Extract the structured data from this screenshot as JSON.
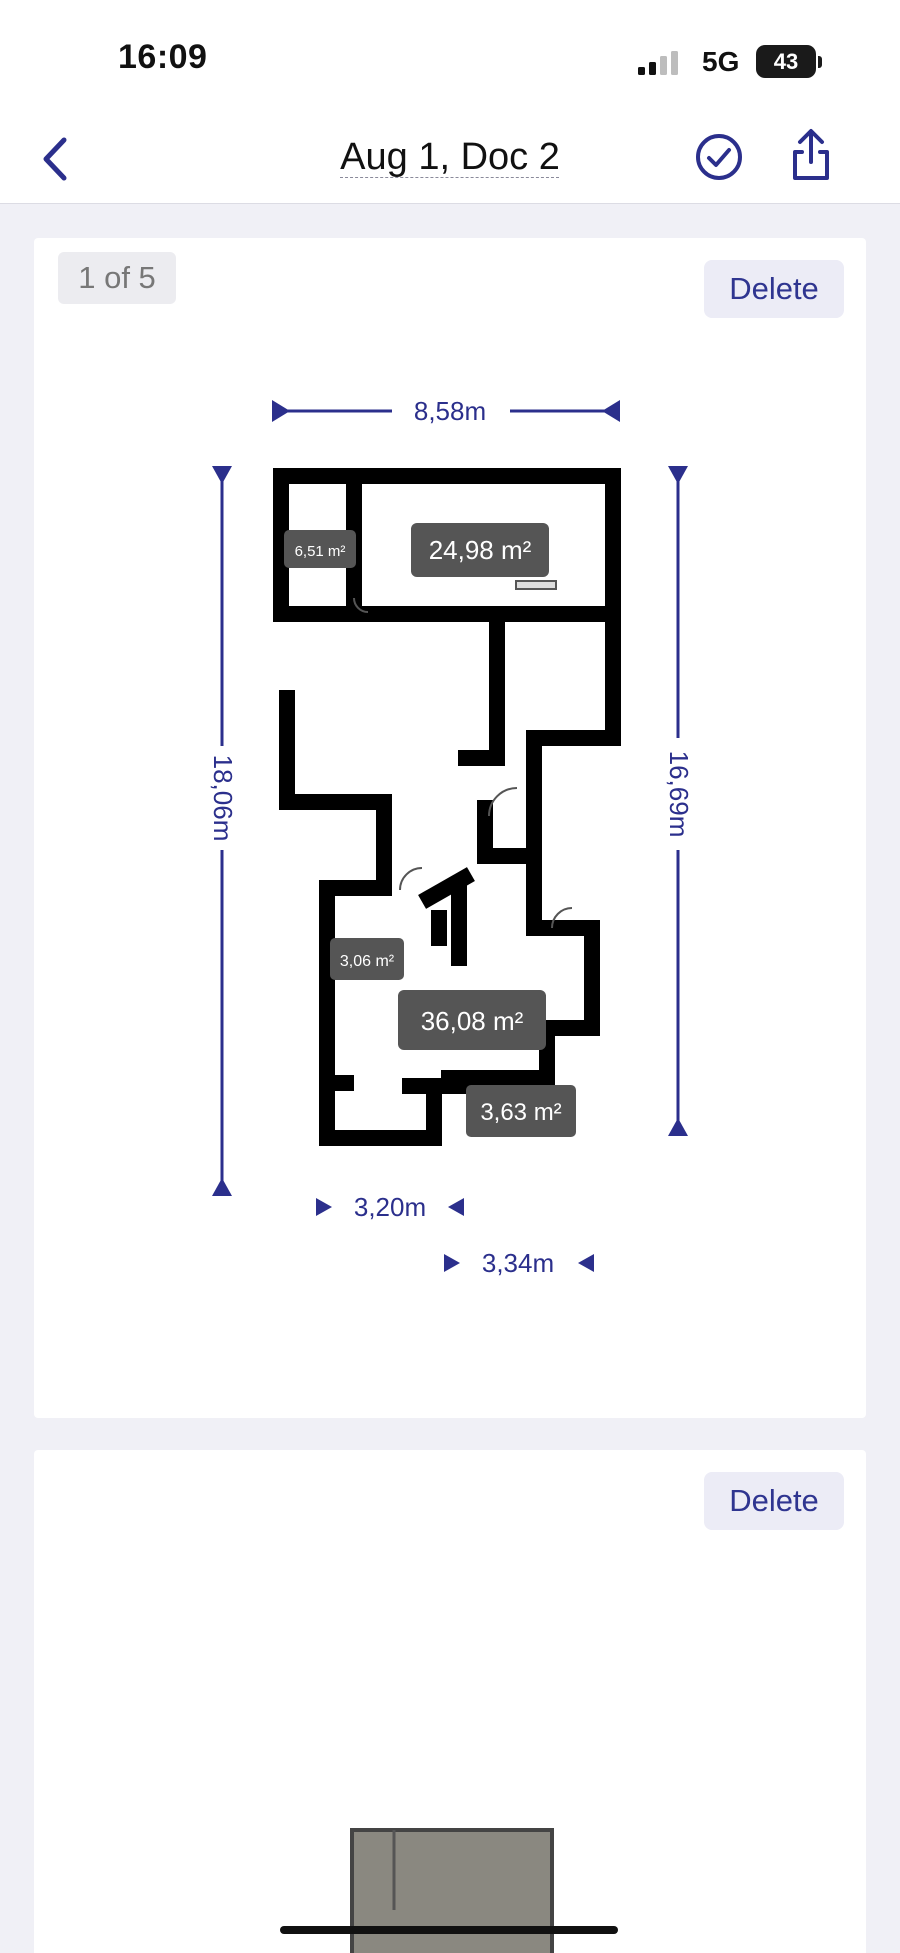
{
  "status_bar": {
    "time": "16:09",
    "network": "5G",
    "battery": "43"
  },
  "nav": {
    "title": "Aug 1, Doc 2",
    "back_icon": "chevron-left-icon",
    "confirm_icon": "checkmark-circle-icon",
    "share_icon": "share-icon"
  },
  "colors": {
    "accent": "#2b2f8c",
    "room_label_bg": "#555555",
    "wall": "#000000"
  },
  "cards": [
    {
      "page_indicator": "1 of 5",
      "delete_label": "Delete",
      "floor_plan": {
        "dimensions": {
          "top_width": "8,58m",
          "left_height": "18,06m",
          "right_height": "16,69m",
          "bottom_width_1": "3,20m",
          "bottom_width_2": "3,34m"
        },
        "rooms": [
          {
            "area": "6,51 m²"
          },
          {
            "area": "24,98 m²"
          },
          {
            "area": "3,06 m²"
          },
          {
            "area": "36,08 m²"
          },
          {
            "area": "3,63 m²"
          }
        ]
      }
    },
    {
      "delete_label": "Delete"
    }
  ]
}
